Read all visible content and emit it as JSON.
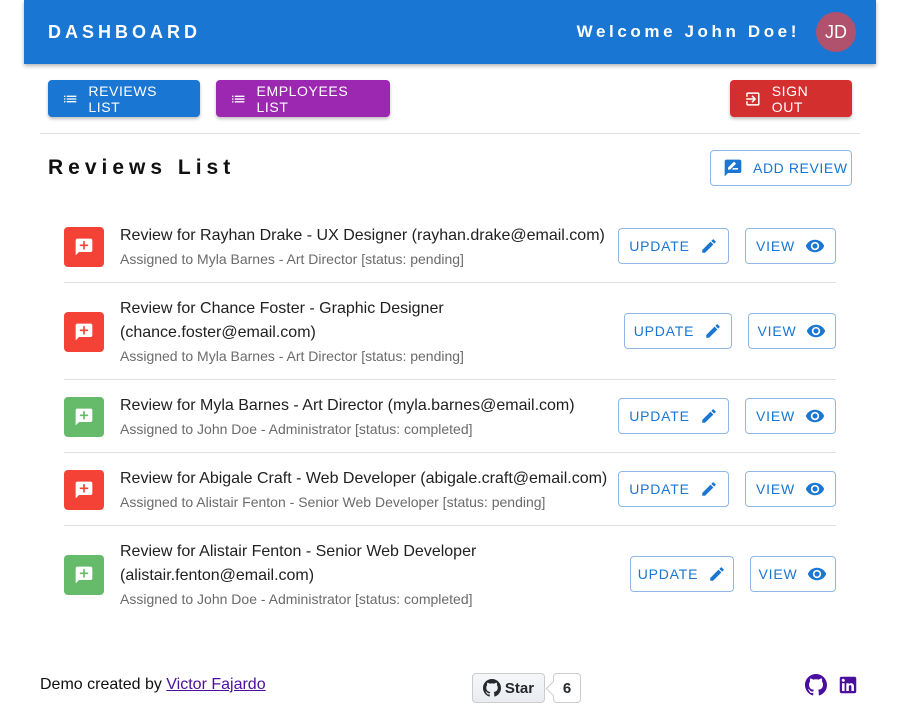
{
  "header": {
    "title": "DASHBOARD",
    "welcome": "Welcome John Doe!",
    "avatar_initials": "JD"
  },
  "toolbar": {
    "reviews_list_label": "REVIEWS LIST",
    "employees_list_label": "EMPLOYEES LIST",
    "sign_out_label": "SIGN OUT"
  },
  "page": {
    "title": "Reviews List",
    "add_review_label": "ADD REVIEW"
  },
  "reviews": [
    {
      "title": "Review for Rayhan Drake - UX Designer (rayhan.drake@email.com)",
      "subtitle": "Assigned to Myla Barnes - Art Director [status: pending]",
      "status": "pending",
      "update_label": "UPDATE",
      "view_label": "VIEW"
    },
    {
      "title": "Review for Chance Foster - Graphic Designer (chance.foster@email.com)",
      "subtitle": "Assigned to Myla Barnes - Art Director [status: pending]",
      "status": "pending",
      "update_label": "UPDATE",
      "view_label": "VIEW"
    },
    {
      "title": "Review for Myla Barnes - Art Director (myla.barnes@email.com)",
      "subtitle": "Assigned to John Doe - Administrator [status: completed]",
      "status": "completed",
      "update_label": "UPDATE",
      "view_label": "VIEW"
    },
    {
      "title": "Review for Abigale Craft - Web Developer (abigale.craft@email.com)",
      "subtitle": "Assigned to Alistair Fenton - Senior Web Developer [status: pending]",
      "status": "pending",
      "update_label": "UPDATE",
      "view_label": "VIEW"
    },
    {
      "title": "Review for Alistair Fenton - Senior Web Developer (alistair.fenton@email.com)",
      "subtitle": "Assigned to John Doe - Administrator [status: completed]",
      "status": "completed",
      "update_label": "UPDATE",
      "view_label": "VIEW"
    }
  ],
  "footer": {
    "credit_prefix": "Demo created by",
    "author_link": "Victor Fajardo",
    "github_star_label": "Star",
    "github_star_count": "6",
    "icons": [
      "github-icon",
      "linkedin-icon"
    ]
  },
  "colors": {
    "primary": "#1976d2",
    "secondary": "#9c27b0",
    "danger": "#d32f2f",
    "pending": "#f44336",
    "completed": "#66bb6a",
    "avatar": "#b0516d",
    "link": "#4b0fa0"
  }
}
